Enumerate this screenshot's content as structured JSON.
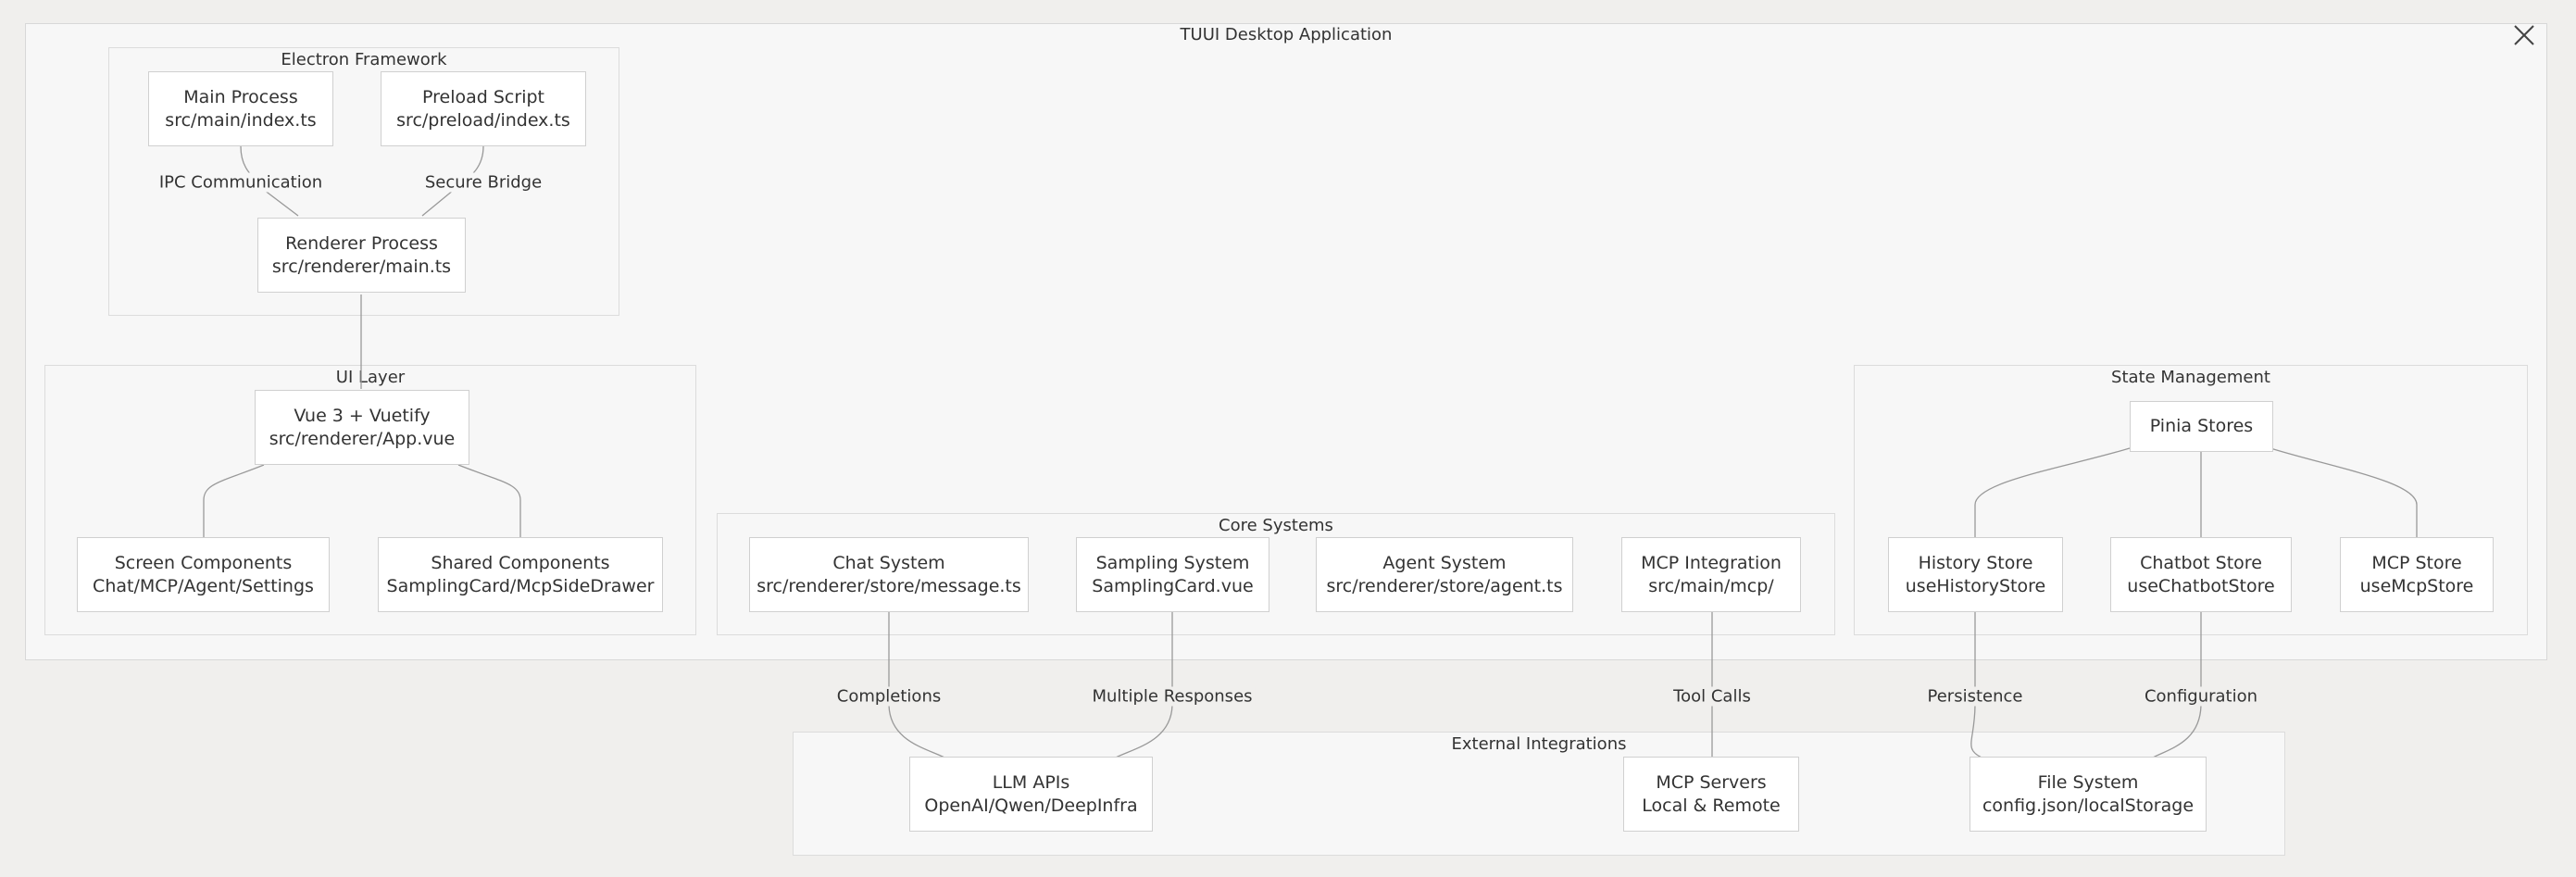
{
  "title": "TUUI Desktop Application",
  "groups": {
    "electron": "Electron Framework",
    "ui": "UI Layer",
    "core": "Core Systems",
    "state": "State Management",
    "external": "External Integrations"
  },
  "nodes": {
    "main": [
      "Main Process",
      "src/main/index.ts"
    ],
    "preload": [
      "Preload Script",
      "src/preload/index.ts"
    ],
    "renderer": [
      "Renderer Process",
      "src/renderer/main.ts"
    ],
    "vue": [
      "Vue 3 + Vuetify",
      "src/renderer/App.vue"
    ],
    "screen": [
      "Screen Components",
      "Chat/MCP/Agent/Settings"
    ],
    "shared": [
      "Shared Components",
      "SamplingCard/McpSideDrawer"
    ],
    "chat": [
      "Chat System",
      "src/renderer/store/message.ts"
    ],
    "sampling": [
      "Sampling System",
      "SamplingCard.vue"
    ],
    "agent": [
      "Agent System",
      "src/renderer/store/agent.ts"
    ],
    "mcp": [
      "MCP Integration",
      "src/main/mcp/"
    ],
    "pinia": [
      "Pinia Stores"
    ],
    "history": [
      "History Store",
      "useHistoryStore"
    ],
    "chatbot": [
      "Chatbot Store",
      "useChatbotStore"
    ],
    "mcpstore": [
      "MCP Store",
      "useMcpStore"
    ],
    "llm": [
      "LLM APIs",
      "OpenAI/Qwen/DeepInfra"
    ],
    "mcpservers": [
      "MCP Servers",
      "Local & Remote"
    ],
    "fs": [
      "File System",
      "config.json/localStorage"
    ]
  },
  "edge_labels": {
    "ipc": "IPC Communication",
    "bridge": "Secure Bridge",
    "completions": "Completions",
    "multiple": "Multiple Responses",
    "toolcalls": "Tool Calls",
    "persistence": "Persistence",
    "configuration": "Configuration"
  },
  "icons": {
    "close": "close-icon"
  }
}
